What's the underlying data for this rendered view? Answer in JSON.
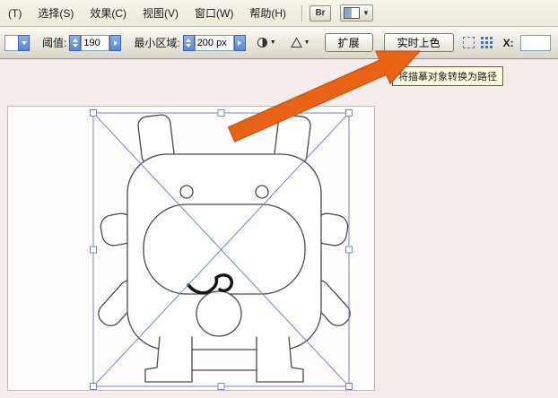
{
  "menu_bar": {
    "items": [
      {
        "label": "(T)"
      },
      {
        "label": "选择(S)"
      },
      {
        "label": "效果(C)"
      },
      {
        "label": "视图(V)"
      },
      {
        "label": "窗口(W)"
      },
      {
        "label": "帮助(H)"
      }
    ],
    "bridge_icon_label": "Br"
  },
  "control_bar": {
    "threshold": {
      "label": "阈值:",
      "value": "190"
    },
    "min_area": {
      "label": "最小区域:",
      "value": "200 px"
    },
    "expand_button_label": "扩展",
    "live_paint_button_label": "实时上色",
    "x_label": "X:"
  },
  "tooltip": {
    "text": "将描摹对象转换为路径"
  },
  "canvas": {
    "selection_color": "#7288c2",
    "artboard_bg": "#fefcfc",
    "pasteboard_bg": "#f5ecec"
  },
  "annotation": {
    "arrow_color": "#e96316"
  }
}
